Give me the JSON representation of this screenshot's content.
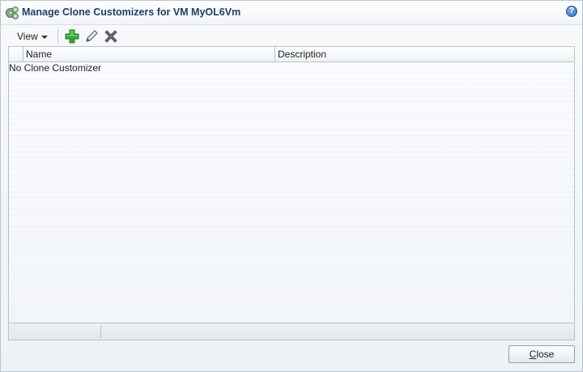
{
  "dialog": {
    "title": "Manage Clone Customizers for VM MyOL6Vm",
    "title_icon": "gear-cluster-icon",
    "help_icon": "help-icon",
    "help_glyph": "?"
  },
  "toolbar": {
    "view_label": "View",
    "add_icon": "add-icon",
    "edit_icon": "edit-pencil-icon",
    "delete_icon": "delete-x-icon"
  },
  "table": {
    "columns": [
      "Name",
      "Description"
    ],
    "empty_message": "No Clone Customizer"
  },
  "footer": {
    "close_mnemonic": "C",
    "close_rest": "lose"
  },
  "colors": {
    "title_text": "#1f3f66",
    "add_green": "#3aa635",
    "delete_gray": "#6b6f73"
  }
}
